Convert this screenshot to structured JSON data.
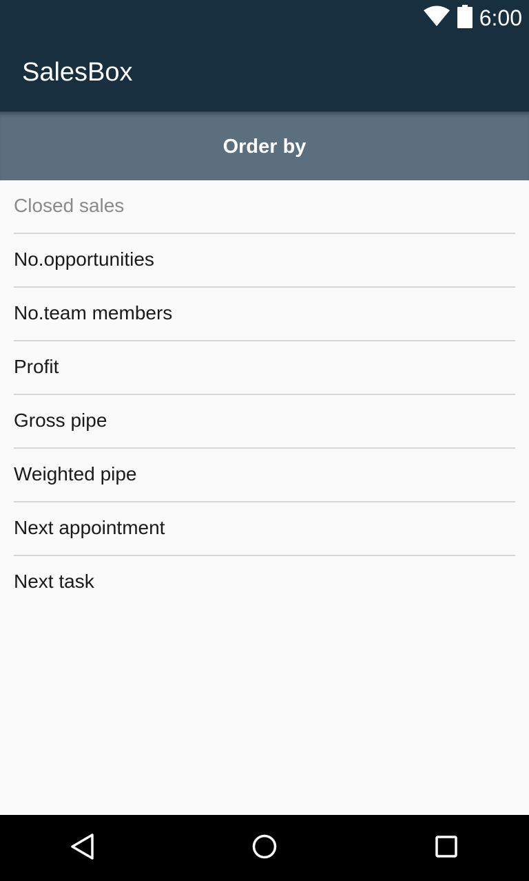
{
  "status_bar": {
    "time": "6:00",
    "icons": [
      "wifi-icon",
      "battery-icon"
    ]
  },
  "app_bar": {
    "title": "SalesBox"
  },
  "sub_header": {
    "title": "Order by"
  },
  "order_options": [
    {
      "label": "Closed sales",
      "state": "disabled"
    },
    {
      "label": "No.opportunities",
      "state": "enabled"
    },
    {
      "label": "No.team members",
      "state": "enabled"
    },
    {
      "label": "Profit",
      "state": "enabled"
    },
    {
      "label": "Gross pipe",
      "state": "enabled"
    },
    {
      "label": "Weighted pipe",
      "state": "enabled"
    },
    {
      "label": "Next appointment",
      "state": "enabled"
    },
    {
      "label": "Next task",
      "state": "enabled"
    }
  ],
  "nav_bar": {
    "icons": [
      "back-icon",
      "home-icon",
      "recents-icon"
    ]
  },
  "colors": {
    "app_bar": "#182f3f",
    "sub_header": "#5b6f7e",
    "background": "#fafafa",
    "divider": "#d6d6d6",
    "nav_bar": "#000000"
  }
}
